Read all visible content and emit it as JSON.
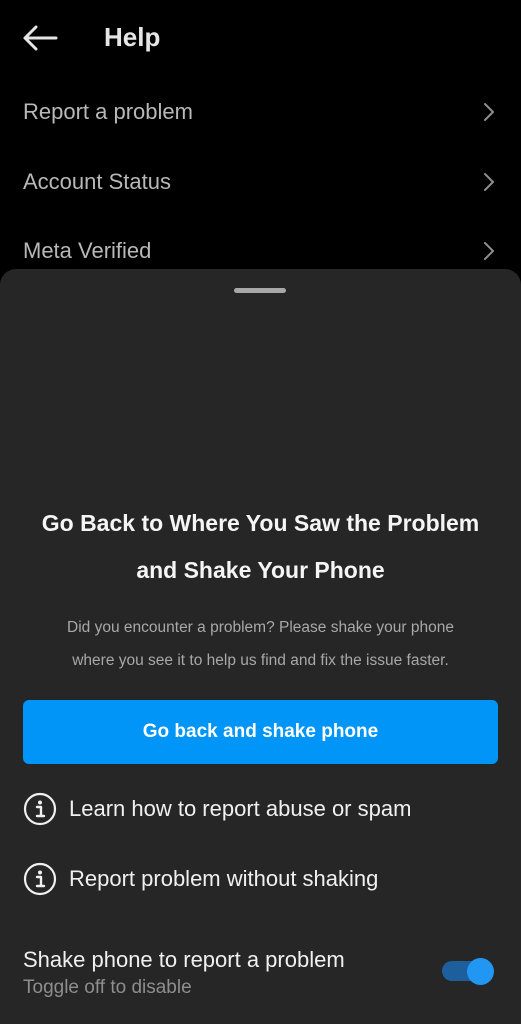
{
  "header": {
    "title": "Help",
    "back_icon": "arrow-left-icon"
  },
  "menu": {
    "items": [
      {
        "label": "Report a problem",
        "icon": "chevron-right-icon"
      },
      {
        "label": "Account Status",
        "icon": "chevron-right-icon"
      },
      {
        "label": "Meta Verified",
        "icon": "chevron-right-icon"
      }
    ]
  },
  "sheet": {
    "title_line1": "Go Back to Where You Saw the Problem",
    "title_line2": "and Shake Your Phone",
    "desc_line1": "Did you encounter a problem? Please shake your phone",
    "desc_line2": "where you see it to help us find and fix the issue faster.",
    "primary_button": "Go back and shake phone",
    "options": [
      {
        "label": "Learn how to report abuse or spam",
        "icon": "info-icon"
      },
      {
        "label": "Report problem without shaking",
        "icon": "info-icon"
      }
    ],
    "shake_setting": {
      "title": "Shake phone to report a problem",
      "subtitle": "Toggle off to disable",
      "enabled": true
    }
  },
  "colors": {
    "background": "#000000",
    "sheet_background": "#262626",
    "accent": "#0095f6",
    "toggle_knob": "#2196f3",
    "toggle_track": "#1d5f9c"
  }
}
